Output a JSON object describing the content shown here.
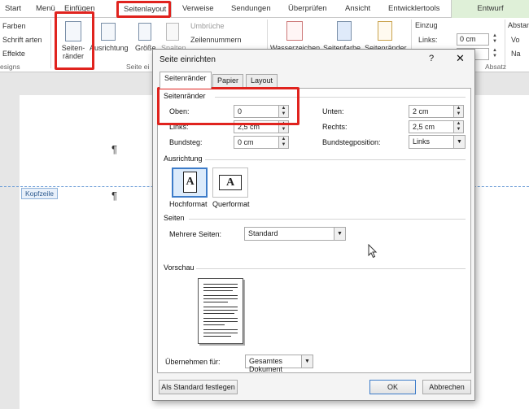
{
  "ribbon": {
    "tabs": [
      "Start",
      "Menü",
      "Einfügen",
      "Seitenlayout",
      "Verweise",
      "Sendungen",
      "Überprüfen",
      "Ansicht",
      "Entwicklertools",
      "Entwurf"
    ],
    "themes_group": {
      "items": [
        "Farben",
        "Schrift arten",
        "Effekte"
      ],
      "label": "esigns"
    },
    "page_setup_group": {
      "margins_label": "Seiten-\nränder",
      "orientation_label": "Ausrichtung",
      "size_label": "Größe",
      "columns_label": "Spalten",
      "breaks_label": "Umbrüche",
      "line_numbers_label": "Zeilennummern",
      "group_label": "Seite ei"
    },
    "background_group": {
      "watermark": "Wasserzeichen",
      "page_color": "Seitenfarbe",
      "page_borders": "Seitenränder"
    },
    "paragraph_group": {
      "indent_title": "Einzug",
      "left_label": "Links:",
      "left_value": "0 cm",
      "right_label": "",
      "spacing_title": "Abstan",
      "before_label": "Vo",
      "after_label": "Na",
      "group_label": "Absatz"
    }
  },
  "document": {
    "pilcrow": "¶",
    "header_tag": "Kopfzeile"
  },
  "dialog": {
    "title": "Seite einrichten",
    "help": "?",
    "close": "✕",
    "tabs": [
      "Seitenränder",
      "Papier",
      "Layout"
    ],
    "margins_section": "Seitenränder",
    "top_label": "Oben:",
    "top_value": "0",
    "left_label": "Links:",
    "left_value": "2,5 cm",
    "gutter_label": "Bundsteg:",
    "gutter_value": "0 cm",
    "bottom_label": "Unten:",
    "bottom_value": "2 cm",
    "right_label": "Rechts:",
    "right_value": "2,5 cm",
    "gutter_pos_label": "Bundstegposition:",
    "gutter_pos_value": "Links",
    "orientation_section": "Ausrichtung",
    "portrait_label": "Hochformat",
    "landscape_label": "Querformat",
    "pages_section": "Seiten",
    "multiple_pages_label": "Mehrere Seiten:",
    "multiple_pages_value": "Standard",
    "preview_section": "Vorschau",
    "apply_to_label": "Übernehmen für:",
    "apply_to_value": "Gesamtes Dokument",
    "set_default_button": "Als Standard festlegen",
    "ok_button": "OK",
    "cancel_button": "Abbrechen",
    "orientation_glyph": "A"
  },
  "colors": {
    "highlight_box": "#e0231e",
    "design_tab": "#dff0d8",
    "selected_orientation": "#dcebfb"
  }
}
